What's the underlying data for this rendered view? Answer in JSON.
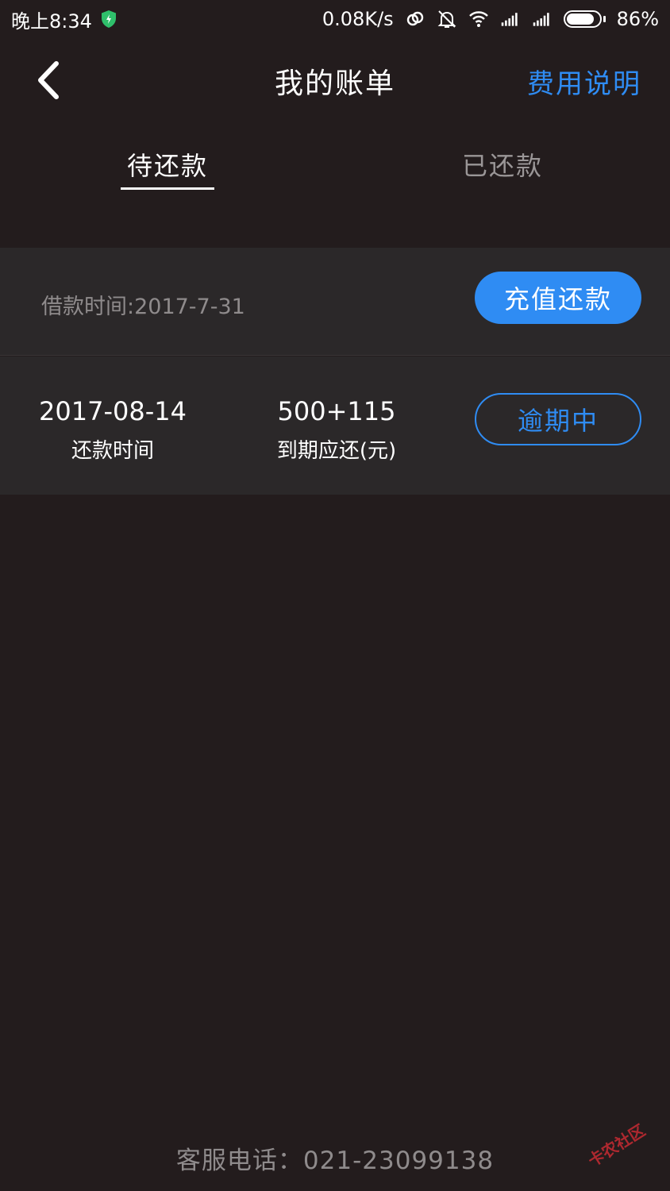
{
  "status_bar": {
    "time": "晚上8:34",
    "network_speed": "0.08K/s",
    "battery_percent": "86%",
    "battery_level": 0.86,
    "icons": [
      "shield-icon",
      "link-icon",
      "mute-bell-icon",
      "wifi-icon",
      "signal-icon",
      "signal-icon",
      "battery-icon"
    ]
  },
  "header": {
    "title": "我的账单",
    "fee_link": "费用说明",
    "back_icon": "chevron-left-icon"
  },
  "tabs": [
    {
      "label": "待还款",
      "active": true
    },
    {
      "label": "已还款",
      "active": false
    }
  ],
  "bill": {
    "loan_date_text": "借款时间:2017-7-31",
    "recharge_button": "充值还款",
    "repay_date": "2017-08-14",
    "repay_date_label": "还款时间",
    "amount_due": "500+115",
    "amount_due_label": "到期应还(元)",
    "status_button": "逾期中"
  },
  "footer": {
    "service_phone": "客服电话：021-23099138",
    "watermark": "卡农社区"
  },
  "colors": {
    "background": "#231c1d",
    "card": "#2b2829",
    "accent": "#2f8cf3",
    "muted_text": "#8f8b8c"
  }
}
